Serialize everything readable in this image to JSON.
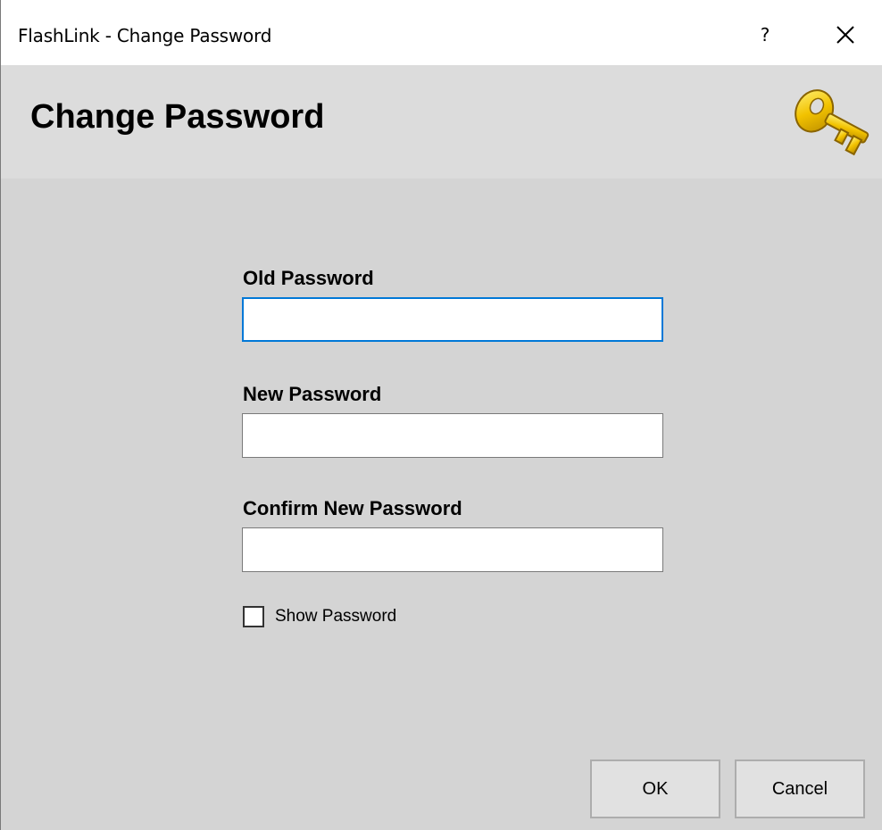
{
  "window": {
    "title": "FlashLink - Change Password",
    "help_label": "?"
  },
  "header": {
    "title": "Change Password",
    "icon": "key-icon"
  },
  "form": {
    "old_password": {
      "label": "Old Password",
      "value": ""
    },
    "new_password": {
      "label": "New Password",
      "value": ""
    },
    "confirm_password": {
      "label": "Confirm New Password",
      "value": ""
    },
    "show_password": {
      "label": "Show Password",
      "checked": false
    }
  },
  "buttons": {
    "ok": "OK",
    "cancel": "Cancel"
  },
  "colors": {
    "focus_border": "#0078d7",
    "key_gold": "#f2c200"
  }
}
